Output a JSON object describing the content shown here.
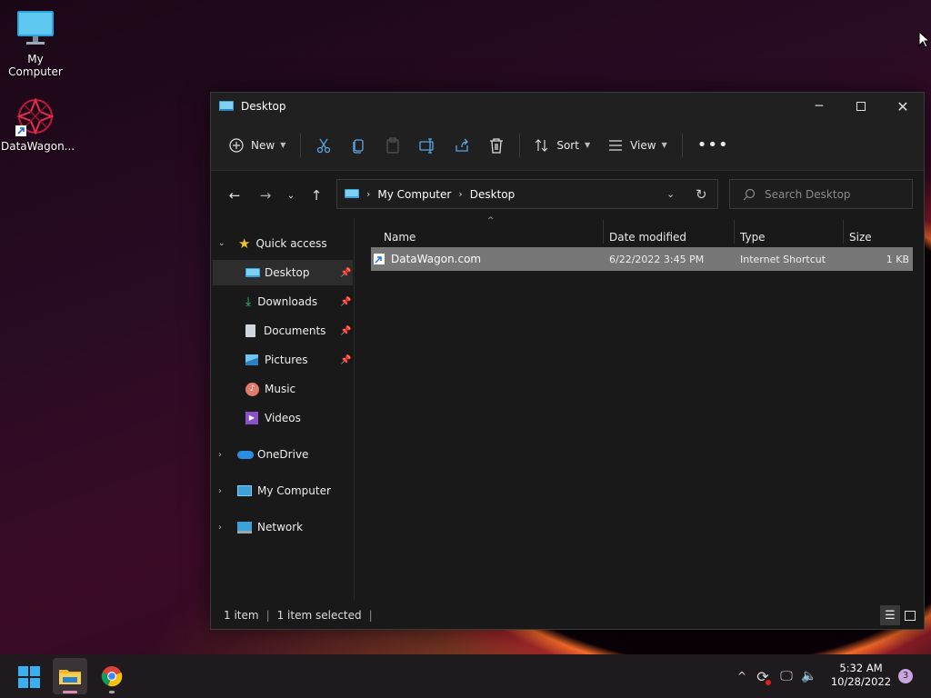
{
  "desktop": {
    "icons": [
      {
        "label": "My Computer",
        "icon": "monitor-icon"
      },
      {
        "label": "DataWagon...",
        "icon": "datawagon-shortcut-icon"
      }
    ]
  },
  "window": {
    "title": "Desktop",
    "toolbar": {
      "new_label": "New",
      "sort_label": "Sort",
      "view_label": "View"
    },
    "breadcrumb": [
      "My Computer",
      "Desktop"
    ],
    "search_placeholder": "Search Desktop",
    "sidebar": {
      "quick_access": "Quick access",
      "items": [
        {
          "label": "Desktop",
          "pinned": true
        },
        {
          "label": "Downloads",
          "pinned": true
        },
        {
          "label": "Documents",
          "pinned": true
        },
        {
          "label": "Pictures",
          "pinned": true
        },
        {
          "label": "Music",
          "pinned": false
        },
        {
          "label": "Videos",
          "pinned": false
        }
      ],
      "onedrive": "OneDrive",
      "my_computer": "My Computer",
      "network": "Network"
    },
    "columns": [
      "Name",
      "Date modified",
      "Type",
      "Size"
    ],
    "files": [
      {
        "name": "DataWagon.com",
        "date": "6/22/2022 3:45 PM",
        "type": "Internet Shortcut",
        "size": "1 KB"
      }
    ],
    "status": {
      "count": "1 item",
      "selected": "1 item selected"
    }
  },
  "taskbar": {
    "time": "5:32 AM",
    "date": "10/28/2022",
    "notifications": "3"
  },
  "colors": {
    "accent": "#5aa7e6",
    "selection": "#777777",
    "window_bg": "#191919"
  }
}
